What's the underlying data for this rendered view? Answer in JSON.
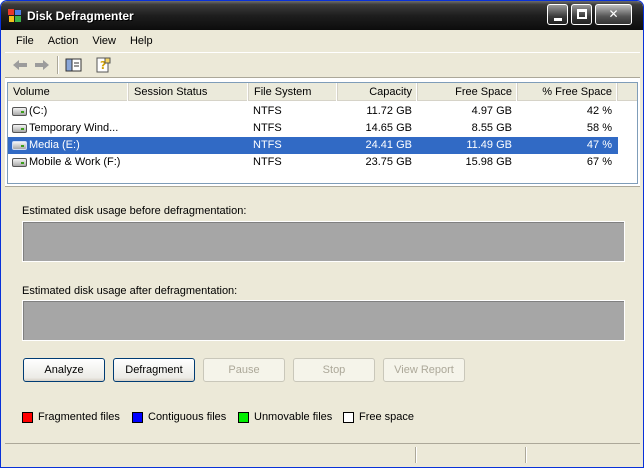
{
  "window": {
    "title": "Disk Defragmenter"
  },
  "menu": [
    "File",
    "Action",
    "View",
    "Help"
  ],
  "columns": [
    "Volume",
    "Session Status",
    "File System",
    "Capacity",
    "Free Space",
    "% Free Space"
  ],
  "volumes": [
    {
      "volume": "(C:)",
      "status": "",
      "fs": "NTFS",
      "capacity": "11.72 GB",
      "free": "4.97 GB",
      "pct": "42 %",
      "selected": false
    },
    {
      "volume": "Temporary Wind...",
      "status": "",
      "fs": "NTFS",
      "capacity": "14.65 GB",
      "free": "8.55 GB",
      "pct": "58 %",
      "selected": false
    },
    {
      "volume": "Media (E:)",
      "status": "",
      "fs": "NTFS",
      "capacity": "24.41 GB",
      "free": "11.49 GB",
      "pct": "47 %",
      "selected": true
    },
    {
      "volume": "Mobile & Work (F:)",
      "status": "",
      "fs": "NTFS",
      "capacity": "23.75 GB",
      "free": "15.98 GB",
      "pct": "67 %",
      "selected": false
    }
  ],
  "before_label": "Estimated disk usage before defragmentation:",
  "after_label": "Estimated disk usage after defragmentation:",
  "buttons": {
    "analyze": "Analyze",
    "defragment": "Defragment",
    "pause": "Pause",
    "stop": "Stop",
    "view_report": "View Report"
  },
  "legend": [
    {
      "label": "Fragmented files",
      "color": "#ff0000"
    },
    {
      "label": "Contiguous files",
      "color": "#0000ff"
    },
    {
      "label": "Unmovable files",
      "color": "#00ee00"
    },
    {
      "label": "Free space",
      "color": "#ffffff"
    }
  ]
}
